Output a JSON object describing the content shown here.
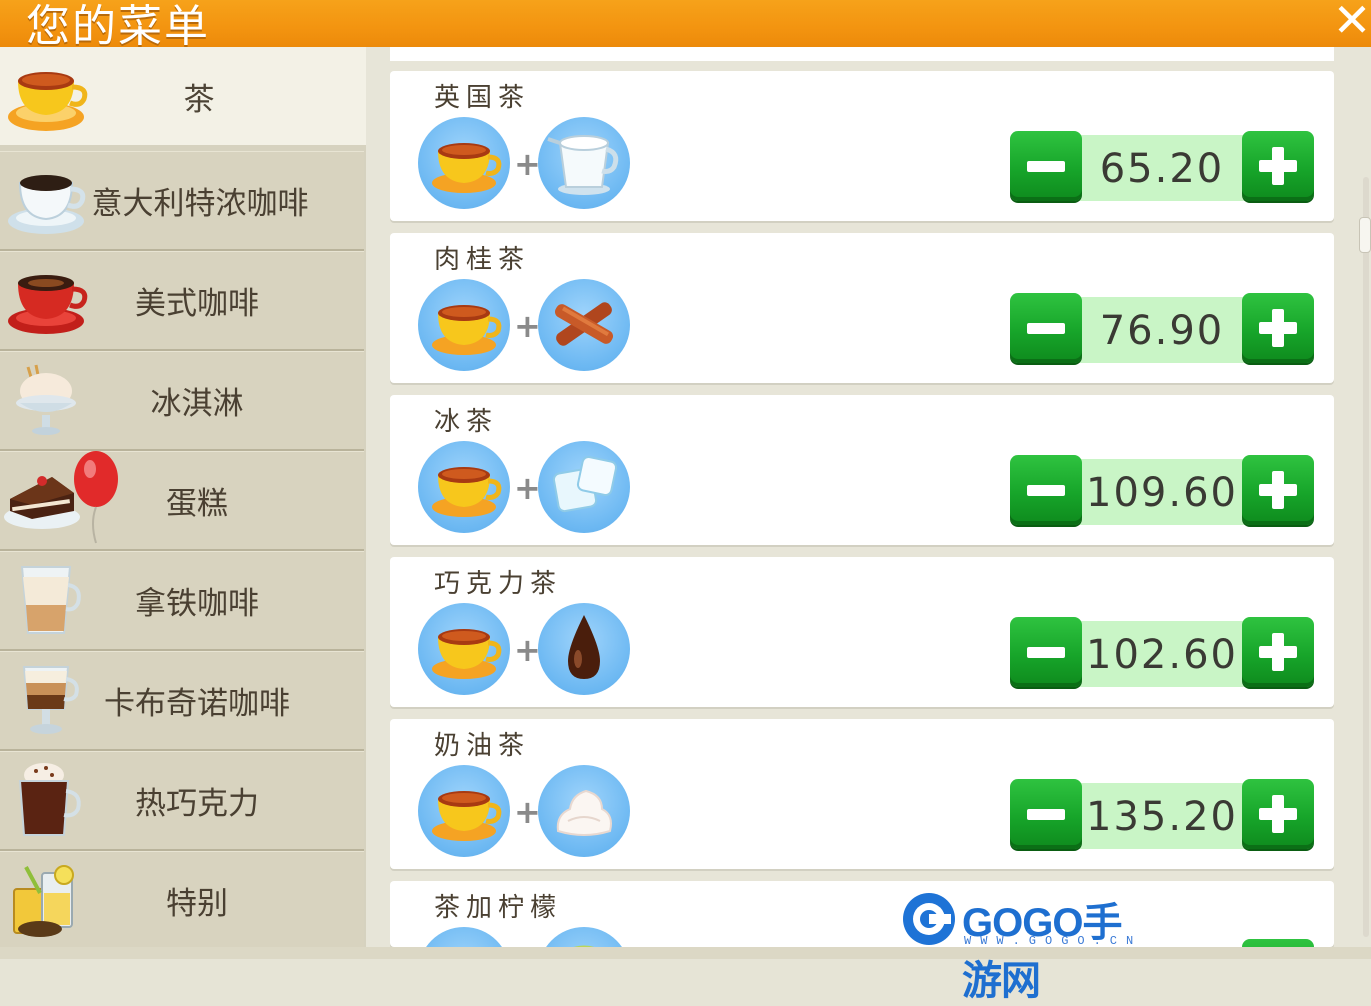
{
  "header": {
    "title": "您的菜单",
    "close_icon": "close-icon"
  },
  "sidebar": {
    "items": [
      {
        "label": "茶",
        "icon": "tea-cup-icon",
        "active": true
      },
      {
        "label": "意大利特浓咖啡",
        "icon": "espresso-cup-icon"
      },
      {
        "label": "美式咖啡",
        "icon": "americano-cup-icon"
      },
      {
        "label": "冰淇淋",
        "icon": "ice-cream-icon"
      },
      {
        "label": "蛋糕",
        "icon": "cake-balloon-icon"
      },
      {
        "label": "拿铁咖啡",
        "icon": "latte-glass-icon"
      },
      {
        "label": "卡布奇诺咖啡",
        "icon": "cappuccino-glass-icon"
      },
      {
        "label": "热巧克力",
        "icon": "hot-chocolate-icon"
      },
      {
        "label": "特别",
        "icon": "special-drinks-icon"
      }
    ]
  },
  "menu": {
    "items": [
      {
        "name": "英国茶",
        "ingredient": "milk-jug-icon",
        "price": "65.20"
      },
      {
        "name": "肉桂茶",
        "ingredient": "cinnamon-sticks-icon",
        "price": "76.90"
      },
      {
        "name": "冰茶",
        "ingredient": "ice-cubes-icon",
        "price": "109.60"
      },
      {
        "name": "巧克力茶",
        "ingredient": "chocolate-drop-icon",
        "price": "102.60"
      },
      {
        "name": "奶油茶",
        "ingredient": "whipped-cream-icon",
        "price": "135.20"
      },
      {
        "name": "茶加柠檬",
        "ingredient": "lemon-icon",
        "price": ""
      }
    ],
    "plus_symbol": "+"
  },
  "watermark": {
    "brand": "GOGO手游网",
    "url": "WWW.GOGO.CN"
  },
  "colors": {
    "header": "#f39410",
    "button_green": "#17a52a",
    "price_bg": "#c9f5c6",
    "ingredient_bg": "#6cb8f2"
  }
}
